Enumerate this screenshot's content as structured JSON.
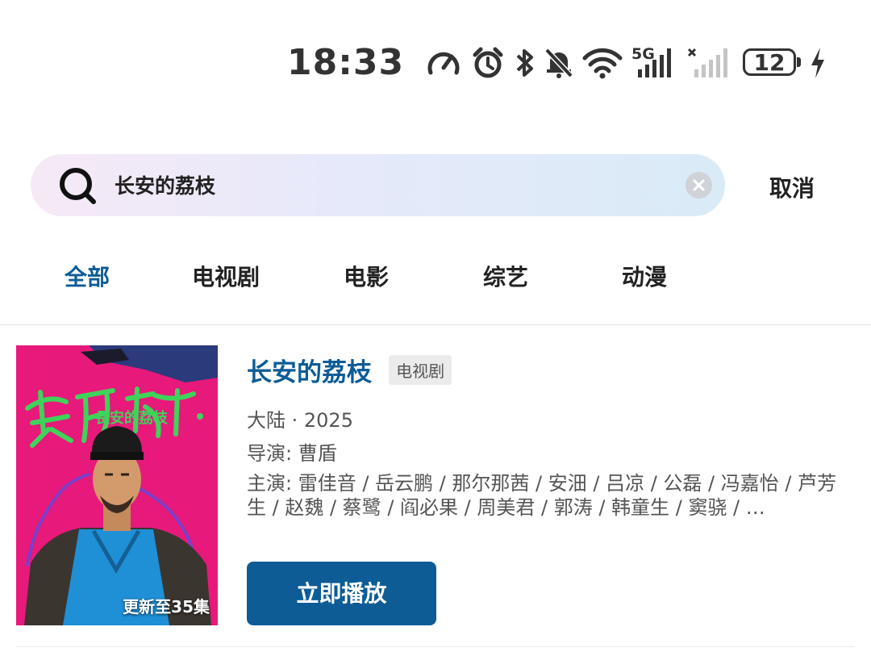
{
  "status_bar": {
    "time": "18:33",
    "network_label": "5G",
    "battery_level": "12",
    "icons": [
      "speed-icon",
      "alarm-icon",
      "bluetooth-icon",
      "mute-icon",
      "wifi-icon",
      "signal-5g-icon",
      "signal-no-sim-icon",
      "battery-icon",
      "charging-icon"
    ]
  },
  "search": {
    "query": "长安的荔枝",
    "cancel_label": "取消"
  },
  "tabs": [
    {
      "label": "全部",
      "active": true
    },
    {
      "label": "电视剧",
      "active": false
    },
    {
      "label": "电影",
      "active": false
    },
    {
      "label": "综艺",
      "active": false
    },
    {
      "label": "动漫",
      "active": false
    }
  ],
  "result": {
    "title": "长安的荔枝",
    "type_tag": "电视剧",
    "region_year": "大陆 · 2025",
    "director": "导演:  曹盾",
    "cast": "主演:  雷佳音 / 岳云鹏 / 那尔那茜 / 安沺 / 吕凉 / 公磊 / 冯嘉怡 / 芦芳生 / 赵魏 / 蔡鹭 / 阎必果 / 周美君 / 郭涛 / 韩童生 / 窦骁 / …",
    "poster_badge": "更新至35集",
    "poster_calligraphy": "長安的荔枝",
    "play_label": "立即播放"
  },
  "colors": {
    "accent": "#0d5c96",
    "poster_bg": "#e7197a",
    "poster_title": "#3fd35a"
  }
}
